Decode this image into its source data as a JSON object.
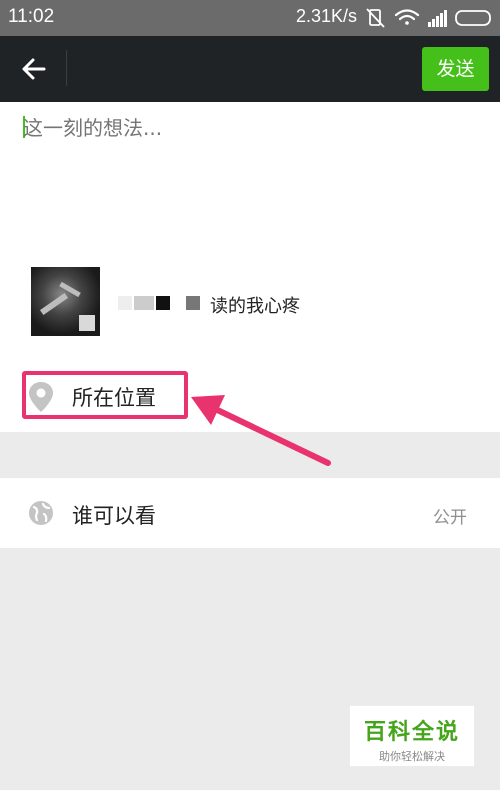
{
  "status_bar": {
    "time": "11:02",
    "speed": "2.31K/s",
    "icons": [
      "vibrate-off-icon",
      "wifi-icon",
      "signal-icon",
      "battery-icon"
    ]
  },
  "action_bar": {
    "back_icon": "back-arrow-icon",
    "send_label": "发送",
    "send_color": "#45c01a"
  },
  "compose": {
    "placeholder": "这一刻的想法...",
    "value": ""
  },
  "attachment": {
    "caption": "读的我心疼"
  },
  "location": {
    "label": "所在位置",
    "icon": "location-pin-icon",
    "highlight_color": "#e8336e"
  },
  "visibility": {
    "label": "谁可以看",
    "value": "公开",
    "icon": "globe-icon"
  },
  "watermark": {
    "title": "百科全说",
    "subtitle": "助你轻松解决"
  }
}
